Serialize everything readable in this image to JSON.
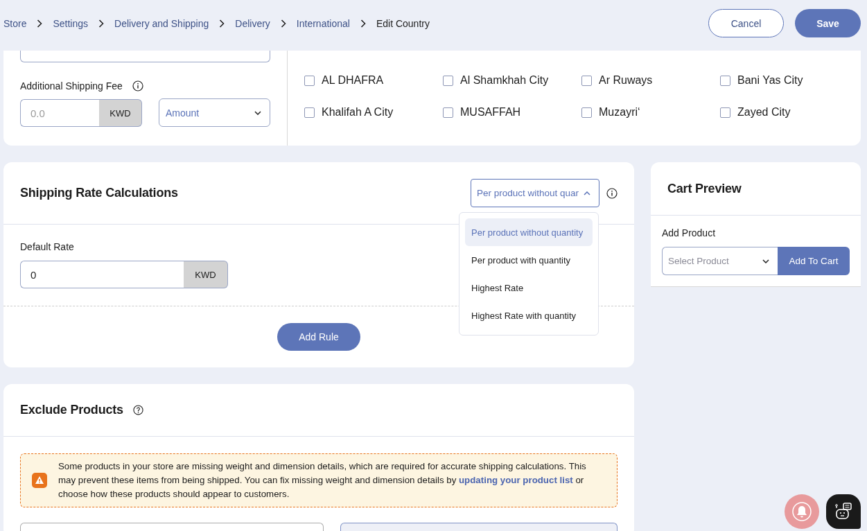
{
  "breadcrumb": [
    {
      "label": "Store",
      "current": false
    },
    {
      "label": "Settings",
      "current": false
    },
    {
      "label": "Delivery and Shipping",
      "current": false
    },
    {
      "label": "Delivery",
      "current": false
    },
    {
      "label": "International",
      "current": false
    },
    {
      "label": "Edit Country",
      "current": true
    }
  ],
  "actions": {
    "cancel": "Cancel",
    "save": "Save"
  },
  "fee": {
    "label": "Additional Shipping Fee",
    "placeholder": "0.0",
    "currency": "KWD",
    "type": "Amount"
  },
  "cities": [
    {
      "label": "AL DHAFRA",
      "checked": false
    },
    {
      "label": "Al Shamkhah City",
      "checked": false
    },
    {
      "label": "Ar Ruways",
      "checked": false
    },
    {
      "label": "Bani Yas City",
      "checked": false
    },
    {
      "label": "Khalifah A City",
      "checked": false
    },
    {
      "label": "MUSAFFAH",
      "checked": false
    },
    {
      "label": "Muzayri‘",
      "checked": false
    },
    {
      "label": "Zayed City",
      "checked": false
    }
  ],
  "rates": {
    "title": "Shipping Rate Calculations",
    "method": "Per product without quar",
    "expanded": true,
    "options": [
      {
        "label": "Per product without quantity",
        "selected": true
      },
      {
        "label": "Per product with quantity",
        "selected": false
      },
      {
        "label": "Highest Rate",
        "selected": false
      },
      {
        "label": "Highest Rate with quantity",
        "selected": false
      }
    ],
    "default_label": "Default Rate",
    "default_value": "0",
    "currency": "KWD",
    "add_rule": "Add Rule"
  },
  "cart": {
    "title": "Cart Preview",
    "label": "Add Product",
    "placeholder": "Select Product",
    "button": "Add To Cart"
  },
  "exclude": {
    "title": "Exclude Products",
    "warning_before": "Some products in your store are missing weight and dimension details, which are required for accurate shipping calculations. This may prevent these items from being shipped. You can fix missing weight and dimension details by",
    "warning_link": "updating your product list",
    "warning_after": "or choose how these products should appear to customers."
  }
}
